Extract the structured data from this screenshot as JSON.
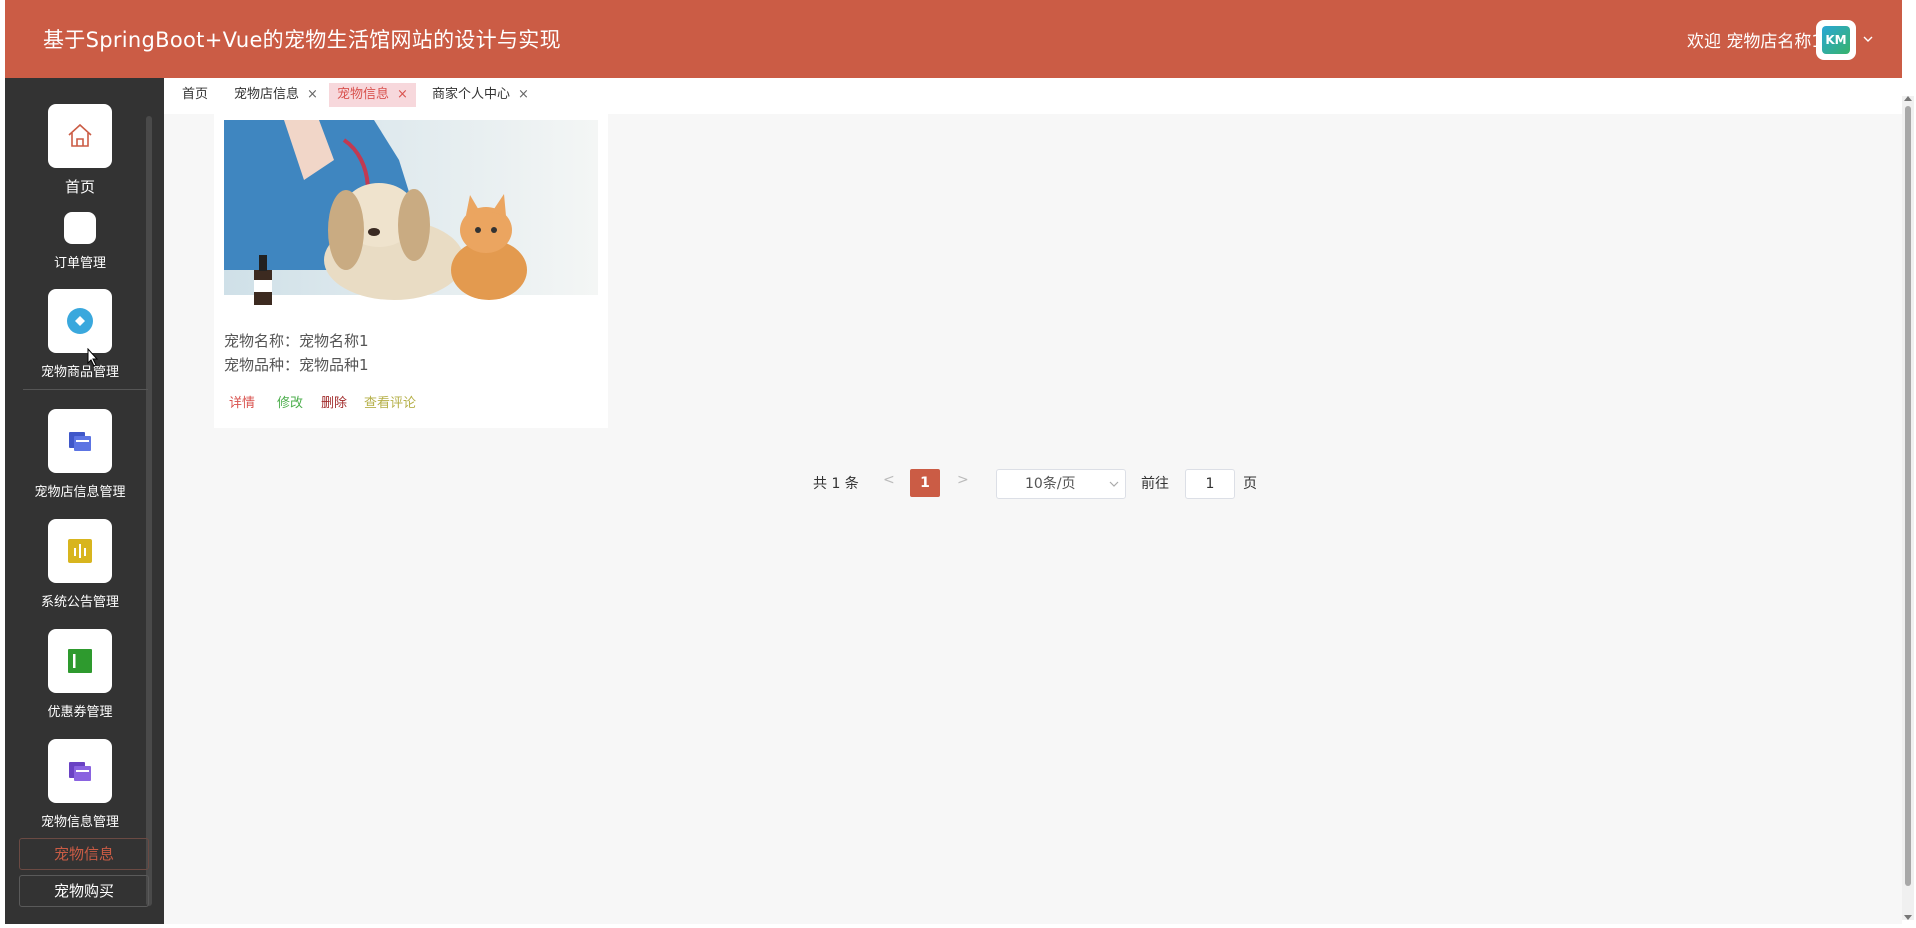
{
  "header": {
    "title": "基于SpringBoot+Vue的宠物生活馆网站的设计与实现",
    "welcome": "欢迎 宠物店名称1",
    "avatar_icon": "brand-logo-icon",
    "avatar_text": "KM",
    "bg_color": "#cb5c45"
  },
  "sidebar": {
    "items": [
      {
        "label": "首页",
        "icon": "home-icon"
      },
      {
        "label": "订单管理",
        "icon": "blank-icon"
      },
      {
        "label": "宠物商品管理",
        "icon": "diamond-icon"
      },
      {
        "label": "宠物店信息管理",
        "icon": "folders-icon"
      },
      {
        "label": "系统公告管理",
        "icon": "chart-icon"
      },
      {
        "label": "优惠券管理",
        "icon": "ticket-icon"
      },
      {
        "label": "宠物信息管理",
        "icon": "folders-icon"
      }
    ],
    "sub_items": [
      {
        "label": "宠物信息",
        "active": true
      },
      {
        "label": "宠物购买",
        "active": false
      }
    ]
  },
  "tabs": [
    {
      "label": "首页",
      "closable": false,
      "active": false
    },
    {
      "label": "宠物店信息",
      "closable": true,
      "active": false
    },
    {
      "label": "宠物信息",
      "closable": true,
      "active": true
    },
    {
      "label": "商家个人中心",
      "closable": true,
      "active": false
    }
  ],
  "close_glyph": "×",
  "card": {
    "image_alt": "pet-photo-dog-and-kitten",
    "name_line": "宠物名称：宠物名称1",
    "breed_line": "宠物品种：宠物品种1",
    "actions": {
      "detail": "详情",
      "edit": "修改",
      "delete": "删除",
      "comments": "查看评论"
    }
  },
  "pagination": {
    "total_text": "共 1 条",
    "prev": "<",
    "current_page": "1",
    "next": ">",
    "page_size": "10条/页",
    "goto_label": "前往",
    "goto_value": "1",
    "page_suffix": "页"
  }
}
